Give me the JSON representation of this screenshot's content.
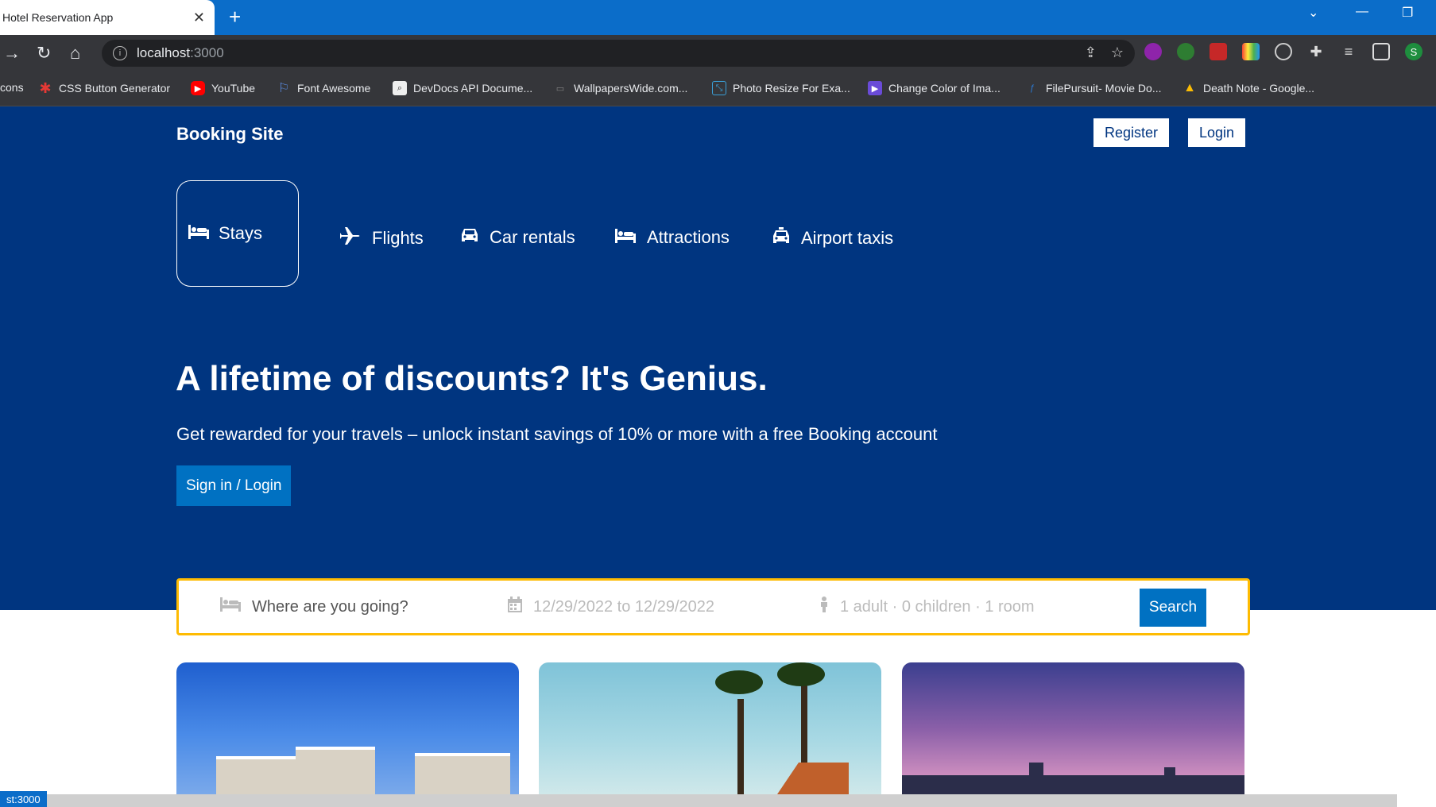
{
  "browser": {
    "tab_title": "Hotel Reservation App",
    "tab_close": "✕",
    "new_tab": "+",
    "url_host": "localhost",
    "url_port": ":3000",
    "status_url": "st:3000",
    "profile_initial": "S"
  },
  "bookmarks": [
    {
      "label": "cons"
    },
    {
      "label": "CSS Button Generator",
      "color": "#e53935"
    },
    {
      "label": "YouTube",
      "color": "#ff0000"
    },
    {
      "label": "Font Awesome",
      "color": "#5a8de6"
    },
    {
      "label": "DevDocs API Docume...",
      "color": "#666"
    },
    {
      "label": "WallpapersWide.com...",
      "color": "#555"
    },
    {
      "label": "Photo Resize For Exa...",
      "color": "#3aa0d8"
    },
    {
      "label": "Change Color of Ima...",
      "color": "#6a4bd8"
    },
    {
      "label": "FilePursuit- Movie Do...",
      "color": "#2a7bd8"
    },
    {
      "label": "Death Note - Google...",
      "color": "#34a853"
    }
  ],
  "site": {
    "brand": "Booking Site",
    "register_label": "Register",
    "login_label": "Login"
  },
  "nav": [
    {
      "label": "Stays",
      "icon": "bed-icon",
      "active": true
    },
    {
      "label": "Flights",
      "icon": "plane-icon"
    },
    {
      "label": "Car rentals",
      "icon": "car-icon"
    },
    {
      "label": "Attractions",
      "icon": "bed-icon"
    },
    {
      "label": "Airport taxis",
      "icon": "taxi-icon"
    }
  ],
  "hero": {
    "headline": "A lifetime of discounts? It's Genius.",
    "subline": "Get rewarded for your travels – unlock instant savings of 10% or more with a free Booking account",
    "signin_label": "Sign in / Login"
  },
  "search": {
    "destination_placeholder": "Where are you going?",
    "dates": "12/29/2022 to 12/29/2022",
    "guests": "1 adult · 0 children · 1 room",
    "button_label": "Search"
  },
  "colors": {
    "hero_bg": "#003580",
    "accent": "#0071c2",
    "search_border": "#febb02"
  }
}
